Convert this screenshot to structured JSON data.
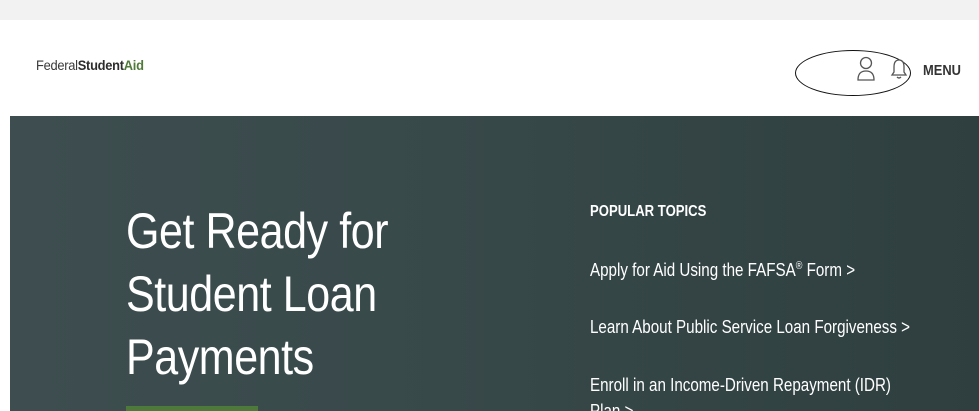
{
  "header": {
    "logo": {
      "federal": "Federal",
      "student": "Student",
      "aid": "Aid"
    },
    "user_icon": "user-icon",
    "bell_icon": "bell-icon",
    "menu_label": "MENU"
  },
  "hero": {
    "title_lines": [
      "Get Ready for",
      "Student Loan",
      "Payments"
    ],
    "popular_topics": {
      "heading": "POPULAR TOPICS",
      "items": [
        {
          "text": "Apply for Aid Using the FAFSA",
          "sup": "®",
          "suffix": " Form >"
        },
        {
          "text": "Learn About Public Service Loan Forgiveness >"
        },
        {
          "text": "Enroll in an Income-Driven Repayment (IDR)",
          "continuation": "Plan >"
        }
      ]
    }
  },
  "colors": {
    "hero_bg": "#3e4e50",
    "accent_green": "#4d7a3b",
    "logo_green": "#4f7a3a"
  }
}
